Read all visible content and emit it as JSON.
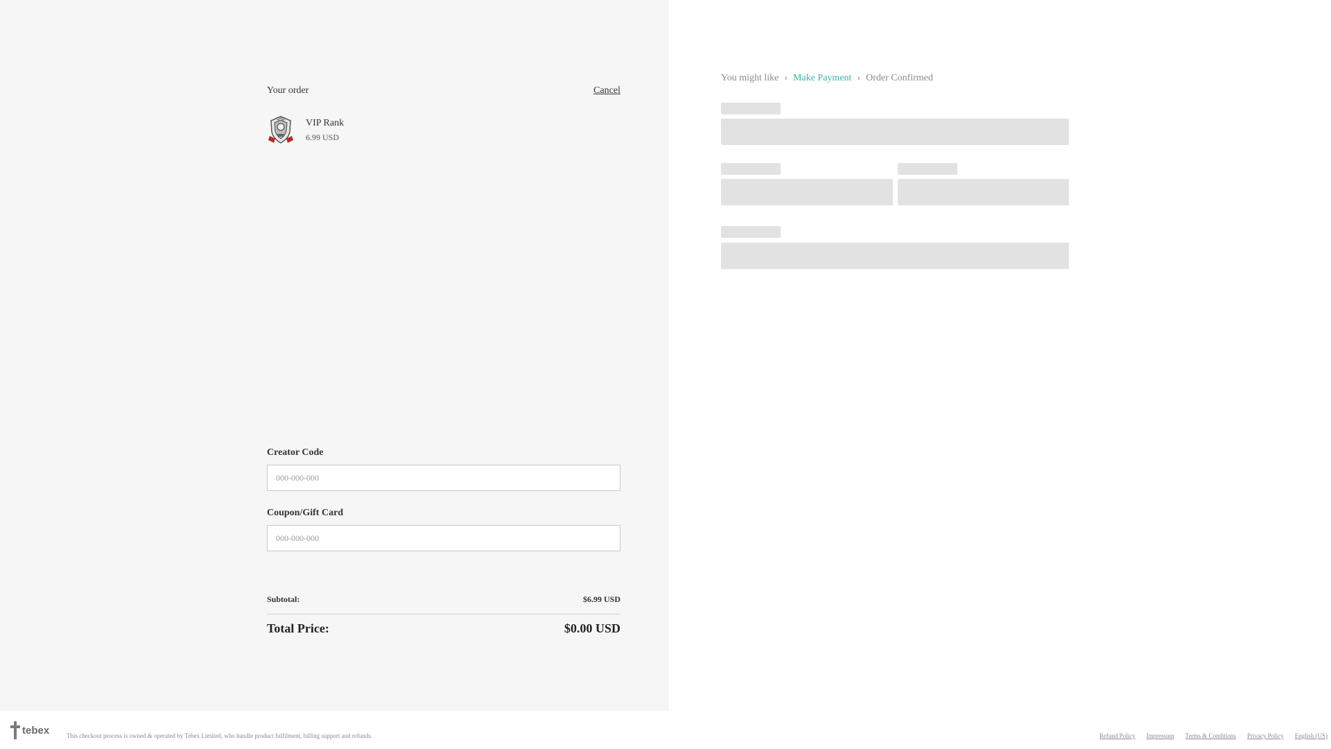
{
  "order": {
    "title": "Your order",
    "cancel_label": "Cancel",
    "items": [
      {
        "name": "VIP Rank",
        "price": "6.99 USD",
        "icon": "vip-rank-shield-icon"
      }
    ]
  },
  "form": {
    "creator_code_label": "Creator Code",
    "creator_code_placeholder": "000-000-000",
    "coupon_label": "Coupon/Gift Card",
    "coupon_placeholder": "000-000-000"
  },
  "totals": {
    "subtotal_label": "Subtotal:",
    "subtotal_value": "$6.99 USD",
    "total_label": "Total Price:",
    "total_value": "$0.00 USD"
  },
  "breadcrumb": {
    "items": [
      "You might like",
      "Make Payment",
      "Order Confirmed"
    ],
    "active_index": 1,
    "separator": "›"
  },
  "footer": {
    "logo_text": "tebex",
    "disclaimer": "This checkout process is owned & operated by Tebex Limited, who handle product fulfilment, billing support and refunds.",
    "links": [
      "Refund Policy",
      "Impressum",
      "Terms & Conditions",
      "Privacy Policy",
      "English (US)"
    ]
  },
  "colors": {
    "accent": "#3cb4a6",
    "left_panel_bg": "#f6f6f6",
    "skeleton": "#e2e2e2"
  }
}
